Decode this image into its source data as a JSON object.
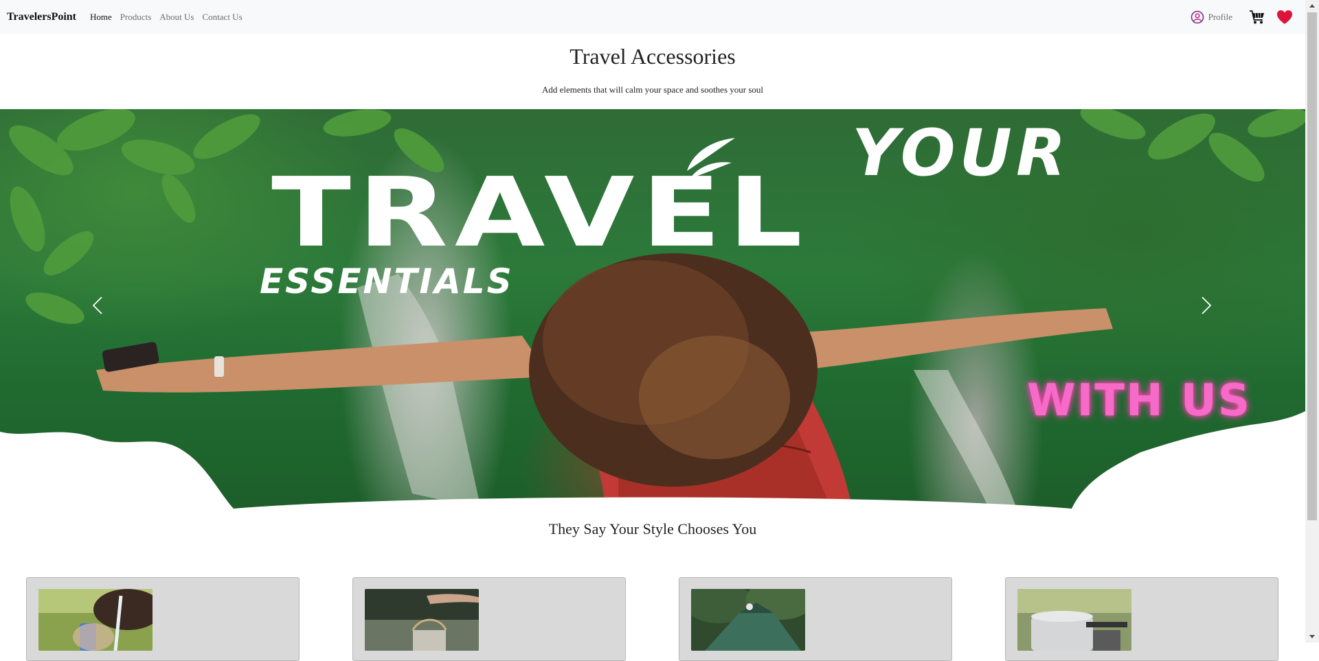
{
  "navbar": {
    "brand": "TravelersPoint",
    "links": [
      {
        "label": "Home",
        "active": true
      },
      {
        "label": "Products",
        "active": false
      },
      {
        "label": "About Us",
        "active": false
      },
      {
        "label": "Contact Us",
        "active": false
      }
    ],
    "profile_label": "Profile",
    "icons": [
      "user-circle-icon",
      "cart-icon",
      "heart-icon"
    ]
  },
  "header": {
    "title": "Travel Accessories",
    "subtitle": "Add elements that will calm your space and soothes your soul"
  },
  "carousel": {
    "line_your": "YOUR",
    "line_travel": "TRAVEL",
    "line_essentials": "ESSENTIALS",
    "line_with_us": "WITH US",
    "prev_icon": "chevron-left-icon",
    "next_icon": "chevron-right-icon"
  },
  "section": {
    "title": "They Say Your Style Chooses You"
  },
  "cards": [
    {
      "image": "water-bottle-image"
    },
    {
      "image": "lantern-image"
    },
    {
      "image": "tent-image"
    },
    {
      "image": "cooking-pot-image"
    }
  ],
  "colors": {
    "navbar_bg": "#f8f9fa",
    "heart": "#dc143c",
    "profile_icon": "#7b2d8e",
    "card_bg": "#d9d9d9",
    "with_us_pink": "#f66bc8"
  }
}
